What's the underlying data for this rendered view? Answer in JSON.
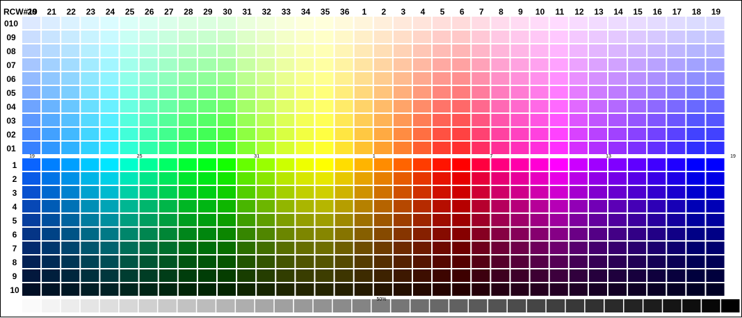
{
  "chart_data": {
    "type": "heatmap",
    "corner_label": "RCW#19",
    "columns": [
      "20",
      "21",
      "22",
      "23",
      "24",
      "25",
      "26",
      "27",
      "28",
      "29",
      "30",
      "31",
      "32",
      "33",
      "34",
      "35",
      "36",
      "1",
      "2",
      "3",
      "4",
      "5",
      "6",
      "7",
      "8",
      "9",
      "10",
      "11",
      "12",
      "13",
      "14",
      "15",
      "16",
      "17",
      "18",
      "19"
    ],
    "tint_rows": [
      "010",
      "09",
      "08",
      "07",
      "06",
      "05",
      "04",
      "03",
      "02",
      "01"
    ],
    "shade_rows": [
      "1",
      "2",
      "3",
      "4",
      "5",
      "6",
      "7",
      "8",
      "9",
      "10"
    ],
    "hue_markers": [
      {
        "label": "19",
        "column": 0
      },
      {
        "label": "25",
        "column": 6
      },
      {
        "label": "31",
        "column": 12
      },
      {
        "label": "1",
        "column": 18
      },
      {
        "label": "7",
        "column": 24
      },
      {
        "label": "13",
        "column": 30
      },
      {
        "label": "19",
        "column": 36
      }
    ],
    "gray_marker": {
      "label": "50%",
      "step": 18
    },
    "gray_steps": 37,
    "gray_range_percent": [
      0,
      100
    ]
  },
  "hue_colors": [
    "#0000ff",
    "#0a64ff",
    "#0080ff",
    "#00a0ff",
    "#00c8ff",
    "#00e6ff",
    "#00ffcc",
    "#00ff99",
    "#00ff66",
    "#00ff33",
    "#00ff1a",
    "#14ff00",
    "#66ff00",
    "#99ff00",
    "#ccff00",
    "#eeff00",
    "#ffff00",
    "#ffdd00",
    "#ffb400",
    "#ff8c00",
    "#ff6400",
    "#ff3c00",
    "#ff1400",
    "#ff0000",
    "#ff0040",
    "#ff0080",
    "#ff00aa",
    "#ff00d4",
    "#ff00ff",
    "#cc00ff",
    "#a000ff",
    "#8000ff",
    "#6000ff",
    "#4000ff",
    "#2000ff",
    "#0000ff"
  ]
}
